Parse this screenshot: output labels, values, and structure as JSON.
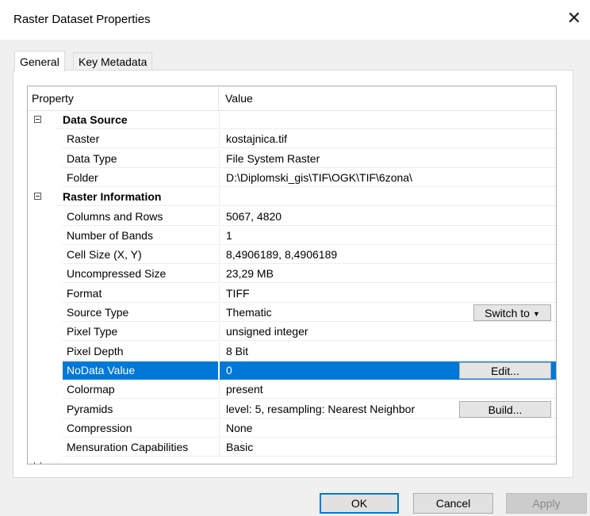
{
  "window": {
    "title": "Raster Dataset Properties",
    "close_glyph": "✕"
  },
  "tabs": [
    {
      "label": "General",
      "active": true
    },
    {
      "label": "Key Metadata",
      "active": false
    }
  ],
  "grid": {
    "columns": [
      "Property",
      "Value"
    ],
    "rows": [
      {
        "kind": "category",
        "property": "Data Source",
        "value": ""
      },
      {
        "kind": "item",
        "property": "Raster",
        "value": "kostajnica.tif"
      },
      {
        "kind": "item",
        "property": "Data Type",
        "value": "File System Raster"
      },
      {
        "kind": "item",
        "property": "Folder",
        "value": "D:\\Diplomski_gis\\TIF\\OGK\\TIF\\6zona\\"
      },
      {
        "kind": "category",
        "property": "Raster Information",
        "value": ""
      },
      {
        "kind": "item",
        "property": "Columns and Rows",
        "value": "5067, 4820"
      },
      {
        "kind": "item",
        "property": "Number of Bands",
        "value": "1"
      },
      {
        "kind": "item",
        "property": "Cell Size (X, Y)",
        "value": "8,4906189, 8,4906189"
      },
      {
        "kind": "item",
        "property": "Uncompressed Size",
        "value": "23,29 MB"
      },
      {
        "kind": "item",
        "property": "Format",
        "value": "TIFF"
      },
      {
        "kind": "item",
        "property": "Source Type",
        "value": "Thematic",
        "button": "Switch to"
      },
      {
        "kind": "item",
        "property": "Pixel Type",
        "value": "unsigned integer"
      },
      {
        "kind": "item",
        "property": "Pixel Depth",
        "value": "8 Bit"
      },
      {
        "kind": "item",
        "property": "NoData Value",
        "value": "0",
        "button": "Edit...",
        "selected": true
      },
      {
        "kind": "item",
        "property": "Colormap",
        "value": "present"
      },
      {
        "kind": "item",
        "property": "Pyramids",
        "value": "level: 5, resampling: Nearest Neighbor",
        "button": "Build..."
      },
      {
        "kind": "item",
        "property": "Compression",
        "value": "None"
      },
      {
        "kind": "item",
        "property": "Mensuration Capabilities",
        "value": "Basic"
      }
    ]
  },
  "scrollbar": {
    "up_glyph": "⌃",
    "down_glyph": "⌄"
  },
  "buttons": {
    "ok": "OK",
    "cancel": "Cancel",
    "apply": "Apply"
  }
}
